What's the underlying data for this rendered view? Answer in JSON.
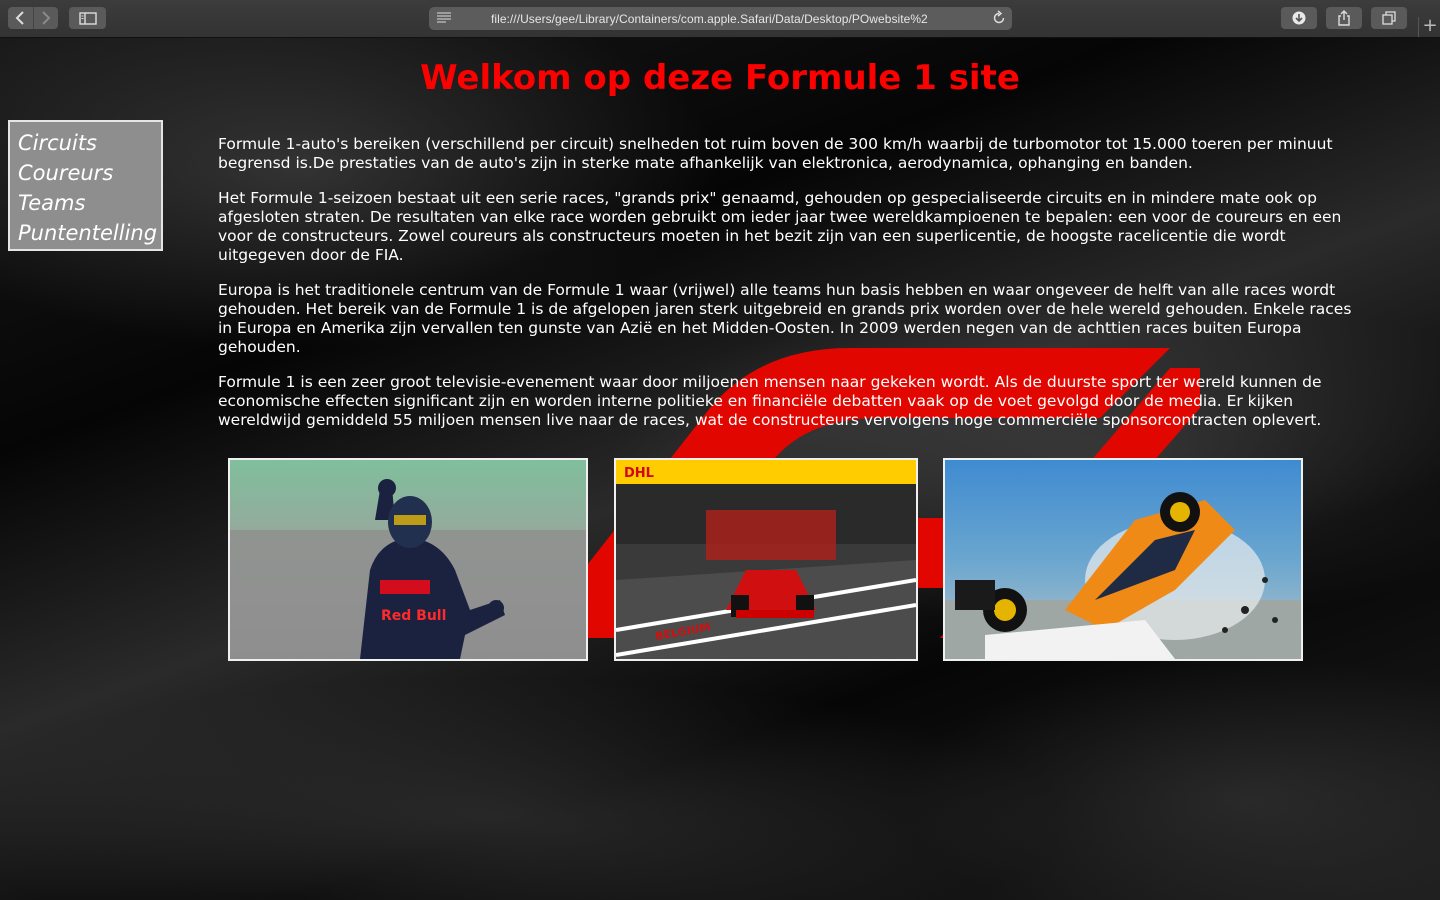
{
  "browser": {
    "url": "file:///Users/gee/Library/Containers/com.apple.Safari/Data/Desktop/POwebsite%2",
    "icons": [
      "back-icon",
      "forward-icon",
      "sidebar-icon",
      "reader-icon",
      "reload-icon",
      "download-icon",
      "share-icon",
      "tabs-icon",
      "new-tab-icon"
    ]
  },
  "page": {
    "title": "Welkom op deze Formule 1 site",
    "title_color": "#ff0000",
    "menu": [
      "Circuits",
      "Coureurs",
      "Teams",
      "Puntentelling"
    ],
    "paragraphs": [
      "Formule 1-auto's bereiken (verschillend per circuit) snelheden tot ruim boven de 300 km/h waarbij de turbomotor tot 15.000 toeren per minuut begrensd is.De prestaties van de auto's zijn in sterke mate afhankelijk van elektronica, aerodynamica, ophanging en banden.",
      "Het Formule 1-seizoen bestaat uit een serie races, \"grands prix\" genaamd, gehouden op gespecialiseerde circuits en in mindere mate ook op afgesloten straten. De resultaten van elke race worden gebruikt om ieder jaar twee wereldkampioenen te bepalen: een voor de coureurs en een voor de constructeurs. Zowel coureurs als constructeurs moeten in het bezit zijn van een superlicentie, de hoogste racelicentie die wordt uitgegeven door de FIA.",
      "Europa is het traditionele centrum van de Formule 1 waar (vrijwel) alle teams hun basis hebben en waar ongeveer de helft van alle races wordt gehouden. Het bereik van de Formule 1 is de afgelopen jaren sterk uitgebreid en grands prix worden over de hele wereld gehouden. Enkele races in Europa en Amerika zijn vervallen ten gunste van Azië en het Midden-Oosten. In 2009 werden negen van de achttien races buiten Europa gehouden.",
      "Formule 1 is een zeer groot televisie-evenement waar door miljoenen mensen naar gekeken wordt. Als de duurste sport ter wereld kunnen de economische effecten significant zijn en worden interne politieke en financiële debatten vaak op de voet gevolgd door de media. Er kijken wereldwijd gemiddeld 55 miljoen mensen live naar de races, wat de constructeurs vervolgens hoge commerciële sponsorcontracten oplevert."
    ],
    "photo_text": {
      "sponsor": "Red Bull",
      "banner": "DHL",
      "pitlane": "BELGIUM"
    }
  }
}
